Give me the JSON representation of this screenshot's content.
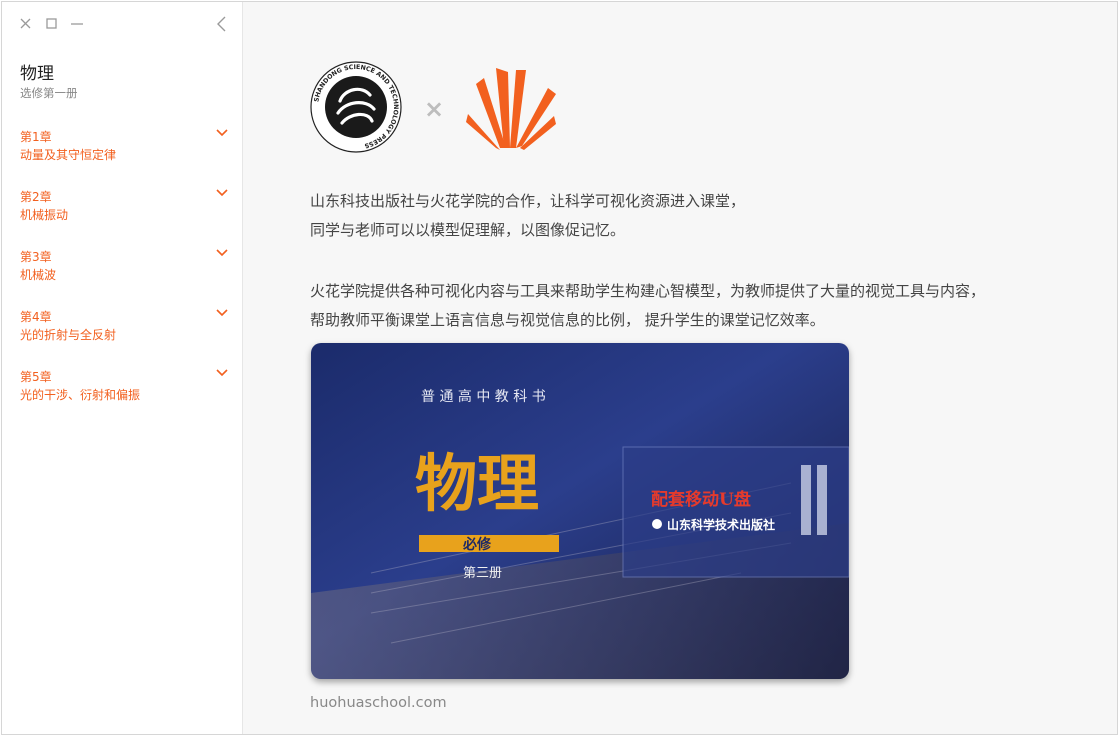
{
  "window": {
    "controls": [
      "close-icon",
      "maximize-icon",
      "minimize-icon"
    ],
    "collapse_icon": "chevron-left-icon"
  },
  "sidebar": {
    "book_title": "物理",
    "book_subtitle": "选修第一册",
    "accent_color": "#f2601f",
    "chapters": [
      {
        "number": "第1章",
        "title": "动量及其守恒定律"
      },
      {
        "number": "第2章",
        "title": "机械振动"
      },
      {
        "number": "第3章",
        "title": "机械波"
      },
      {
        "number": "第4章",
        "title": "光的折射与全反射"
      },
      {
        "number": "第5章",
        "title": "光的干涉、衍射和偏振"
      }
    ]
  },
  "main": {
    "partner_separator": "×",
    "publisher_logo_text": "SHANDONG SCIENCE AND TECHNOLOGY PRESS",
    "paragraph1": [
      "山东科技出版社与火花学院的合作，让科学可视化资源进入课堂，",
      "同学与老师可以以模型促理解，以图像促记忆。"
    ],
    "paragraph2": [
      "火花学院提供各种可视化内容与工具来帮助学生构建心智模型，为教师提供了大量的视觉工具与内容，",
      "帮助教师平衡课堂上语言信息与视觉信息的比例， 提升学生的课堂记忆效率。"
    ],
    "cover": {
      "series": "普 通 高 中 教 科 书",
      "title": "物理",
      "required": "必修",
      "volume": "第三册",
      "usb": "配套移动U盘",
      "publisher": "山东科学技术出版社"
    },
    "footer": "huohuaschool.com"
  }
}
